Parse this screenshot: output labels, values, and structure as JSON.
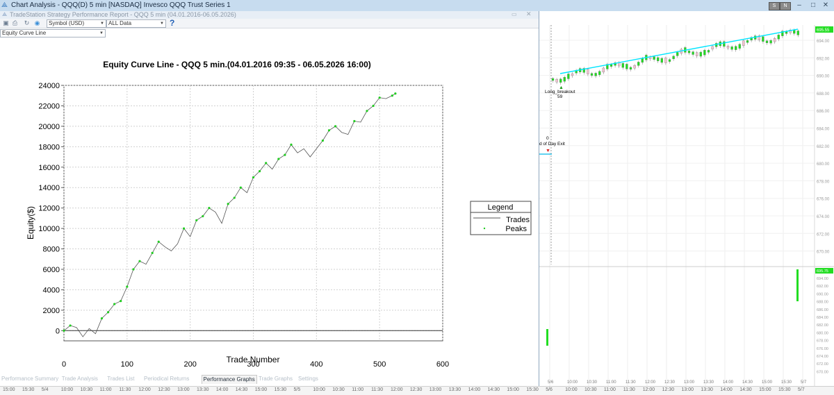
{
  "window": {
    "title": "Chart Analysis - QQQ(D) 5 min [NASDAQ] Invesco QQQ Trust Series 1",
    "buttons": [
      "S",
      "N",
      "–",
      "□",
      "✕"
    ]
  },
  "report": {
    "title": "TradeStation Strategy Performance Report - QQQ 5 min (04.01.2016-06.05.2026)",
    "symbol_combo": "Symbol (USD)",
    "data_combo": "ALL Data",
    "help": "?",
    "graph_select": "Equity Curve Line",
    "tabs": [
      "Performance Summary",
      "Trade Analysis",
      "Trades List",
      "Periodical Returns",
      "Performance Graphs",
      "Trade Graphs",
      "Settings"
    ],
    "active_tab": "Performance Graphs"
  },
  "chart_data": {
    "type": "line",
    "title": "Equity Curve Line - QQQ 5 min.(04.01.2016 09:35 - 06.05.2026 16:00)",
    "xlabel": "Trade Number",
    "ylabel": "Equity($)",
    "xlim": [
      0,
      600
    ],
    "ylim": [
      -1000,
      24000
    ],
    "x_ticks": [
      0,
      100,
      200,
      300,
      400,
      500,
      600
    ],
    "y_ticks": [
      0,
      2000,
      4000,
      6000,
      8000,
      10000,
      12000,
      14000,
      16000,
      18000,
      20000,
      22000,
      24000
    ],
    "grid": true,
    "legend": {
      "title": "Legend",
      "position": "right",
      "entries": [
        "Trades",
        "Peaks"
      ]
    },
    "series": [
      {
        "name": "Trades",
        "color": "#555555",
        "x": [
          0,
          10,
          20,
          30,
          40,
          50,
          60,
          70,
          80,
          90,
          100,
          110,
          120,
          130,
          140,
          150,
          160,
          170,
          180,
          190,
          200,
          210,
          220,
          230,
          240,
          250,
          260,
          270,
          280,
          290,
          300,
          310,
          320,
          330,
          340,
          350,
          360,
          370,
          380,
          390,
          400,
          410,
          420,
          430,
          440,
          450,
          460,
          470,
          480,
          490,
          500,
          510,
          520,
          525
        ],
        "y": [
          0,
          500,
          300,
          -600,
          200,
          -300,
          1200,
          1800,
          2600,
          2900,
          4300,
          6000,
          6800,
          6500,
          7600,
          8700,
          8200,
          7800,
          8500,
          10000,
          9200,
          10800,
          11200,
          12000,
          11600,
          10500,
          12400,
          13000,
          14000,
          13500,
          15000,
          15600,
          16400,
          15800,
          16800,
          17200,
          18200,
          17400,
          17800,
          17000,
          17800,
          18600,
          19600,
          20000,
          19400,
          19200,
          20500,
          20400,
          21500,
          22000,
          22800,
          22700,
          23000,
          23200
        ]
      },
      {
        "name": "Peaks",
        "color": "#22cc22"
      }
    ]
  },
  "price_chart": {
    "price_labels": [
      "694.00",
      "692.00",
      "690.00",
      "688.00",
      "686.00",
      "684.00",
      "682.00",
      "680.00",
      "678.00",
      "676.00",
      "674.00",
      "672.00",
      "670.00"
    ],
    "last_price": "695.55",
    "lower_last": "695.75",
    "lower_labels": [
      "694.00",
      "692.00",
      "690.00",
      "688.00",
      "686.00",
      "684.00",
      "682.00",
      "680.00",
      "678.00",
      "676.00",
      "674.00",
      "672.00",
      "670.00"
    ],
    "annotation_long": "Long_breakout",
    "annotation_long_num": "59",
    "annotation_exit": "d of Day Exit",
    "annotation_exit_num": "0",
    "time_labels": [
      "5/6",
      "10:00",
      "10:30",
      "11:00",
      "11:30",
      "12:00",
      "12:30",
      "13:00",
      "13:30",
      "14:00",
      "14:30",
      "15:00",
      "15:30",
      "5/7"
    ]
  },
  "time_axis": [
    "15:00",
    "15:30",
    "5/4",
    "10:00",
    "10:30",
    "11:00",
    "11:30",
    "12:00",
    "12:30",
    "13:00",
    "13:30",
    "14:00",
    "14:30",
    "15:00",
    "15:30",
    "5/5",
    "10:00",
    "10:30",
    "11:00",
    "11:30",
    "12:00",
    "12:30",
    "13:00",
    "13:30",
    "14:00",
    "14:30",
    "15:00",
    "15:30",
    "5/6",
    "10:00",
    "10:30",
    "11:00",
    "11:30",
    "12:00",
    "12:30",
    "13:00",
    "13:30",
    "14:00",
    "14:30",
    "15:00",
    "15:30",
    "5/7"
  ],
  "colors": {
    "accent": "#00e5ff",
    "up": "#22dd22",
    "down": "#e8a8b8",
    "titlebar": "#c7dcef"
  }
}
